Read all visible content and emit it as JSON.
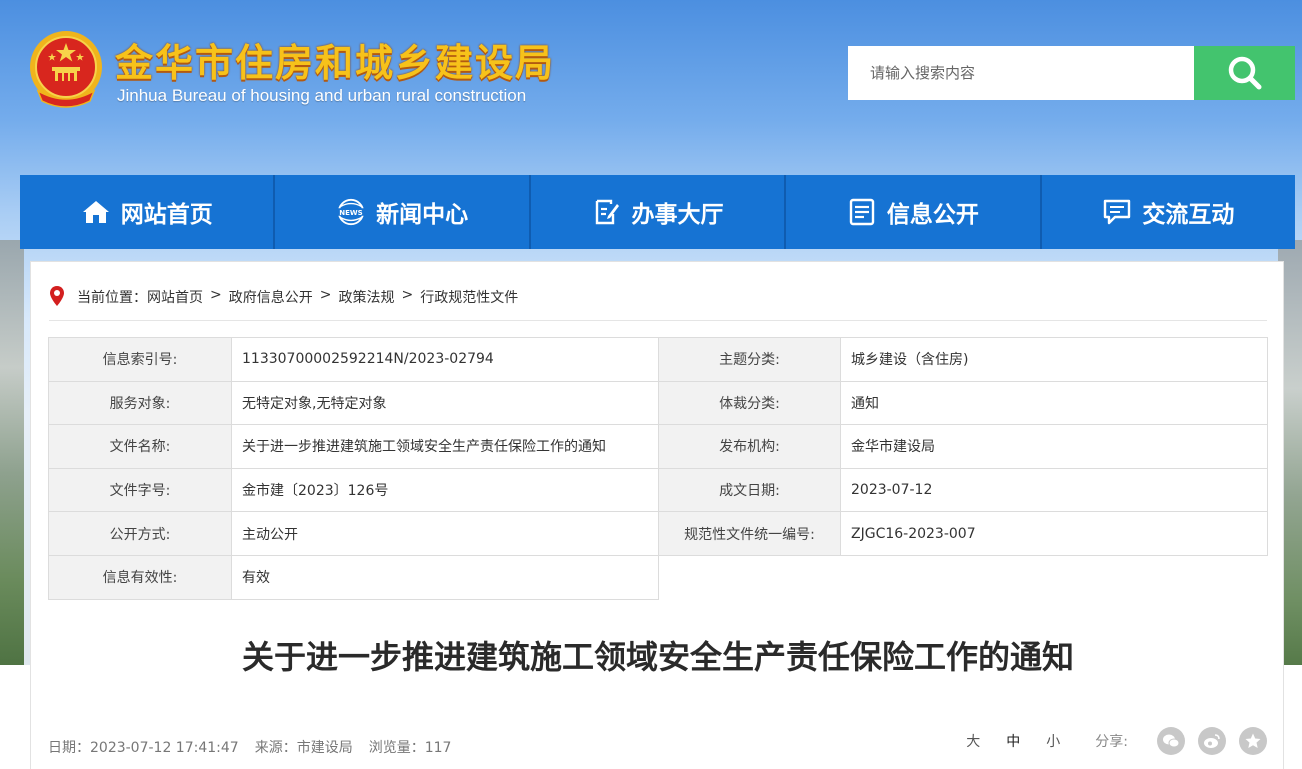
{
  "header": {
    "title": "金华市住房和城乡建设局",
    "subtitle": "Jinhua Bureau of housing and urban rural construction",
    "search_placeholder": "请输入搜索内容"
  },
  "colors": {
    "nav_blue": "#1673d3",
    "search_green": "#43c46e",
    "title_gold": "#f7c21a"
  },
  "nav": [
    {
      "label": "网站首页",
      "icon": "home-icon"
    },
    {
      "label": "新闻中心",
      "icon": "news-icon"
    },
    {
      "label": "办事大厅",
      "icon": "edit-doc-icon"
    },
    {
      "label": "信息公开",
      "icon": "list-doc-icon"
    },
    {
      "label": "交流互动",
      "icon": "chat-icon"
    }
  ],
  "breadcrumb": {
    "prefix": "当前位置：",
    "items": [
      "网站首页",
      "政府信息公开",
      "政策法规",
      "行政规范性文件"
    ],
    "separator": ">"
  },
  "meta": {
    "rows": [
      [
        {
          "label": "信息索引号:",
          "value": "11330700002592214N/2023-02794"
        },
        {
          "label": "主题分类:",
          "value": "城乡建设（含住房)"
        }
      ],
      [
        {
          "label": "服务对象:",
          "value": "无特定对象,无特定对象"
        },
        {
          "label": "体裁分类:",
          "value": "通知"
        }
      ],
      [
        {
          "label": "文件名称:",
          "value": "关于进一步推进建筑施工领域安全生产责任保险工作的通知"
        },
        {
          "label": "发布机构:",
          "value": "金华市建设局"
        }
      ],
      [
        {
          "label": "文件字号:",
          "value": "金市建〔2023〕126号"
        },
        {
          "label": "成文日期:",
          "value": "2023-07-12"
        }
      ],
      [
        {
          "label": "公开方式:",
          "value": "主动公开"
        },
        {
          "label": "规范性文件统一编号:",
          "value": "ZJGC16-2023-007"
        }
      ],
      [
        {
          "label": "信息有效性:",
          "value": "有效"
        }
      ]
    ]
  },
  "article": {
    "title": "关于进一步推进建筑施工领域安全生产责任保险工作的通知",
    "date": "日期：2023-07-12 17:41:47",
    "source": "来源：市建设局",
    "views": "浏览量：117",
    "font_sizes": [
      "大",
      "中",
      "小"
    ],
    "share_label": "分享:",
    "share_icons": [
      "wechat-icon",
      "weibo-icon",
      "favorite-icon"
    ]
  }
}
